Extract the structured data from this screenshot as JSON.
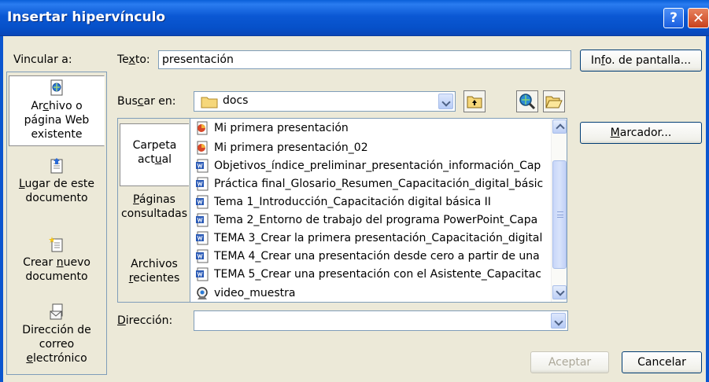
{
  "window": {
    "title": "Insertar hipervínculo",
    "help_glyph": "?",
    "close_glyph": "✕"
  },
  "nav": {
    "caption": "Vincular a:",
    "items": [
      {
        "id": "existing-file",
        "line1": "Archivo o",
        "line2": "página Web",
        "line3": "existente",
        "selected": true,
        "icon": "web-page-icon"
      },
      {
        "id": "place-in-doc",
        "line1": "Lugar de este",
        "line2": "documento",
        "line3": "",
        "selected": false,
        "icon": "document-place-icon"
      },
      {
        "id": "new-doc",
        "line1": "Crear nuevo",
        "line2": "documento",
        "line3": "",
        "selected": false,
        "icon": "new-document-icon"
      },
      {
        "id": "email",
        "line1": "Dirección de",
        "line2": "correo",
        "line3": "electrónico",
        "selected": false,
        "icon": "email-icon"
      }
    ]
  },
  "text_field": {
    "label": "Texto:",
    "value": "presentación"
  },
  "screen_tip_button": "Info. de pantalla...",
  "lookin": {
    "label": "Buscar en:",
    "value": "docs"
  },
  "subnav": {
    "items": [
      {
        "line1": "Carpeta",
        "line2": "actual",
        "selected": true
      },
      {
        "line1": "Páginas",
        "line2": "consultadas",
        "selected": false
      },
      {
        "line1": "Archivos",
        "line2": "recientes",
        "selected": false
      }
    ]
  },
  "files": [
    {
      "name": "Mi primera presentación",
      "type": "ppt"
    },
    {
      "name": "Mi primera presentación_02",
      "type": "ppt"
    },
    {
      "name": "Objetivos_índice_preliminar_presentación_información_Cap",
      "type": "doc"
    },
    {
      "name": "Práctica final_Glosario_Resumen_Capacitación_digital_básic",
      "type": "doc"
    },
    {
      "name": "Tema 1_Introducción_Capacitación digital básica II",
      "type": "doc"
    },
    {
      "name": "Tema 2_Entorno de trabajo del programa PowerPoint_Capa",
      "type": "doc"
    },
    {
      "name": "TEMA 3_Crear la primera presentación_Capacitación_digital",
      "type": "doc"
    },
    {
      "name": "TEMA 4_Crear una presentación desde cero a partir de una",
      "type": "doc"
    },
    {
      "name": "TEMA 5_Crear una presentación con el Asistente_Capacitac",
      "type": "doc"
    },
    {
      "name": "video_muestra",
      "type": "video"
    }
  ],
  "bookmark_button": "Marcador...",
  "address": {
    "label": "Dirección:",
    "value": ""
  },
  "ok_button": "Aceptar",
  "cancel_button": "Cancelar"
}
